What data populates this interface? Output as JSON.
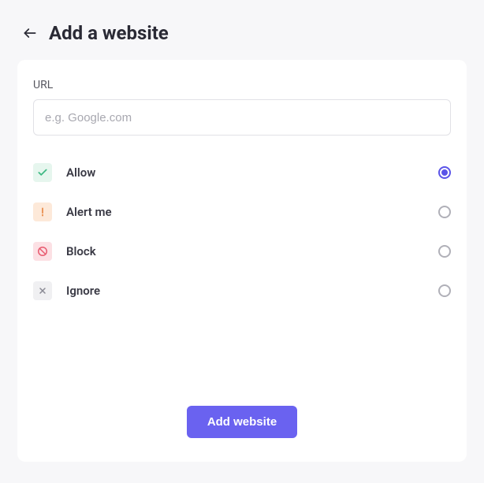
{
  "header": {
    "title": "Add a website"
  },
  "form": {
    "url_label": "URL",
    "url_placeholder": "e.g. Google.com",
    "url_value": ""
  },
  "options": [
    {
      "key": "allow",
      "label": "Allow",
      "icon": "check-icon",
      "selected": true
    },
    {
      "key": "alert",
      "label": "Alert me",
      "icon": "alert-icon",
      "selected": false
    },
    {
      "key": "block",
      "label": "Block",
      "icon": "block-icon",
      "selected": false
    },
    {
      "key": "ignore",
      "label": "Ignore",
      "icon": "close-icon",
      "selected": false
    }
  ],
  "actions": {
    "submit_label": "Add website"
  },
  "colors": {
    "accent": "#6a62f0",
    "allow": "#3fb984",
    "alert": "#e88b4a",
    "block": "#e85a6f",
    "ignore": "#8a8a94"
  }
}
